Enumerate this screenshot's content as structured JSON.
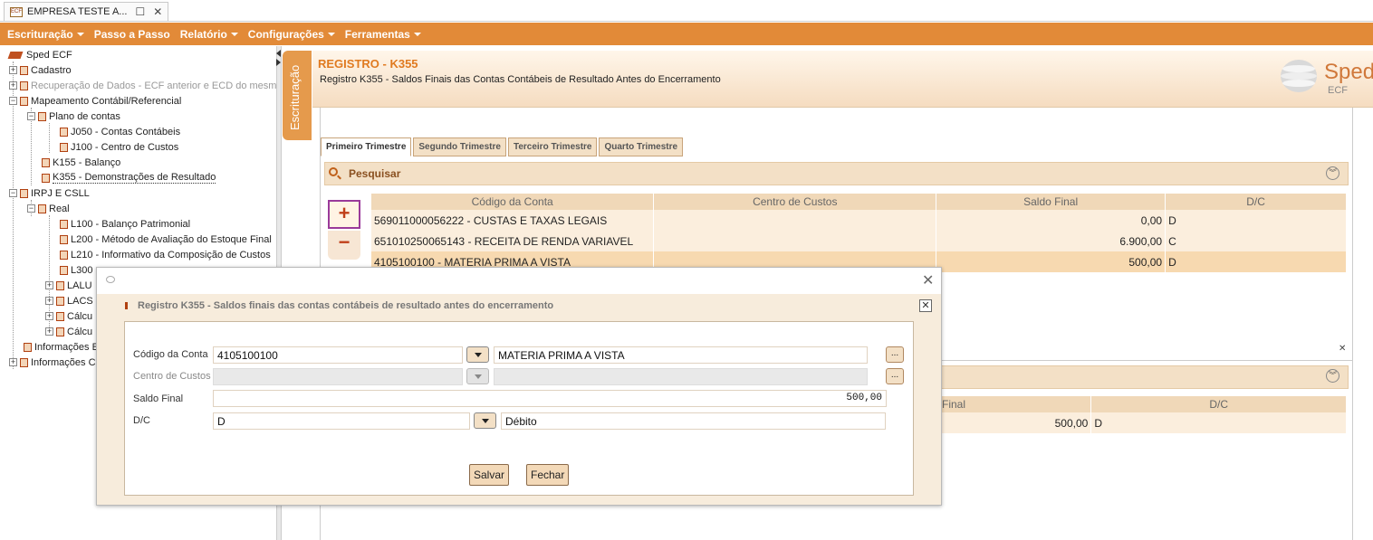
{
  "window": {
    "tab_title": "EMPRESA TESTE A...",
    "app_icon": "ECF"
  },
  "menu": [
    {
      "label": "Escrituração",
      "has_caret": true
    },
    {
      "label": "Passo a Passo",
      "has_caret": false
    },
    {
      "label": "Relatório",
      "has_caret": true
    },
    {
      "label": "Configurações",
      "has_caret": true
    },
    {
      "label": "Ferramentas",
      "has_caret": true
    }
  ],
  "tree": {
    "root": "Sped ECF",
    "items": [
      "Cadastro",
      "Recuperação de Dados - ECF anterior e ECD do mesmo",
      "Mapeamento Contábil/Referencial",
      "Plano de contas",
      "J050 - Contas Contábeis",
      "J100 - Centro de Custos",
      "K155 - Balanço",
      "K355 - Demonstrações de Resultado",
      "IRPJ E CSLL",
      "Real",
      "L100 - Balanço Patrimonial",
      "L200 - Método de Avaliação do Estoque Final",
      "L210 - Informativo da Composição de Custos",
      "L300",
      "LALU",
      "LACS",
      "Cálcu",
      "Cálcu",
      "Informações E",
      "Informações C"
    ]
  },
  "side_tab": "Escrituração",
  "header": {
    "title": "REGISTRO - K355",
    "subtitle": "Registro K355 - Saldos Finais das Contas Contábeis de Resultado Antes do Encerramento",
    "logo": "Sped",
    "logo_sub": "ECF"
  },
  "quarter_tabs": [
    "Primeiro Trimestre",
    "Segundo Trimestre",
    "Terceiro Trimestre",
    "Quarto Trimestre"
  ],
  "search": {
    "label": "Pesquisar"
  },
  "grid": {
    "columns": [
      "Código da Conta",
      "Centro de Custos",
      "Saldo Final",
      "D/C"
    ],
    "rows": [
      {
        "conta": "569011000056222 - CUSTAS E TAXAS LEGAIS",
        "centro": "",
        "saldo": "0,00",
        "dc": "D"
      },
      {
        "conta": "651010250065143 - RECEITA DE RENDA VARIAVEL",
        "centro": "",
        "saldo": "6.900,00",
        "dc": "C"
      },
      {
        "conta": "4105100100 - MATERIA PRIMA A VISTA",
        "centro": "",
        "saldo": "500,00",
        "dc": "D"
      }
    ]
  },
  "lower_grid": {
    "columns": [
      "Final",
      "D/C"
    ],
    "rows": [
      {
        "saldo": "500,00",
        "dc": "D"
      }
    ]
  },
  "dialog": {
    "title": "Registro K355 - Saldos finais das contas contábeis de resultado antes do encerramento",
    "fields": {
      "codigo_label": "Código da Conta",
      "codigo_value": "4105100100",
      "codigo_desc": "MATERIA PRIMA A VISTA",
      "centro_label": "Centro de Custos",
      "centro_value": "",
      "centro_desc": "",
      "saldo_label": "Saldo Final",
      "saldo_value": "500,00",
      "dc_label": "D/C",
      "dc_value": "D",
      "dc_desc": "Débito"
    },
    "ellipsis": "...",
    "save_label": "Salvar",
    "close_label": "Fechar"
  }
}
